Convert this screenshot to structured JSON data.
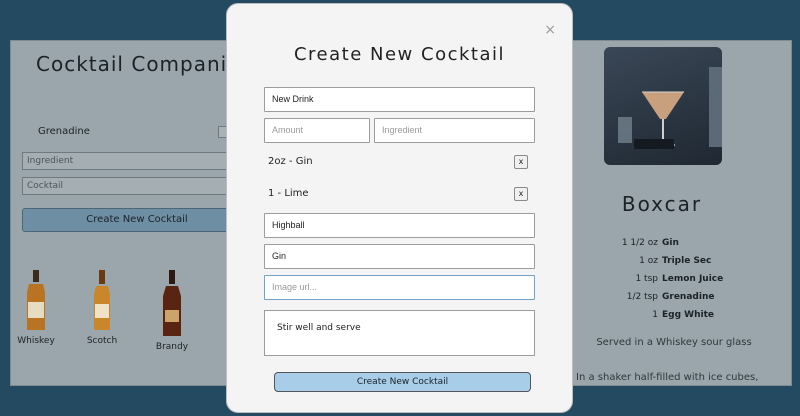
{
  "background": {
    "app_title": "Cocktail Companion",
    "grenadine_label": "Grenadine",
    "ingredient_placeholder": "Ingredient",
    "cocktail_placeholder": "Cocktail",
    "create_button": "Create New Cocktail",
    "bottles": [
      "Whiskey",
      "Scotch",
      "Brandy"
    ],
    "featured": {
      "name": "Boxcar",
      "ingredients": [
        {
          "amount": "1 1/2 oz",
          "name": "Gin"
        },
        {
          "amount": "1 oz",
          "name": "Triple Sec"
        },
        {
          "amount": "1 tsp",
          "name": "Lemon Juice"
        },
        {
          "amount": "1/2 tsp",
          "name": "Grenadine"
        },
        {
          "amount": "1",
          "name": "Egg White"
        }
      ],
      "served": "Served in a Whiskey sour glass",
      "method": "In a shaker half-filled with ice cubes,"
    }
  },
  "modal": {
    "title": "Create New Cocktail",
    "close_icon": "×",
    "name_value": "New Drink",
    "amount_placeholder": "Amount",
    "ingredient_placeholder": "Ingredient",
    "ingredients": [
      {
        "text": "2oz - Gin",
        "remove": "x"
      },
      {
        "text": "1 - Lime",
        "remove": "x"
      }
    ],
    "glass_value": "Highball",
    "spirit_value": "Gin",
    "image_placeholder": "Image url...",
    "instructions_value": "Stir well and serve",
    "submit_label": "Create New Cocktail"
  },
  "colors": {
    "submit_button": "#a7cde8",
    "modal_bg": "#f4f4f4",
    "page_bg": "#244a62"
  }
}
